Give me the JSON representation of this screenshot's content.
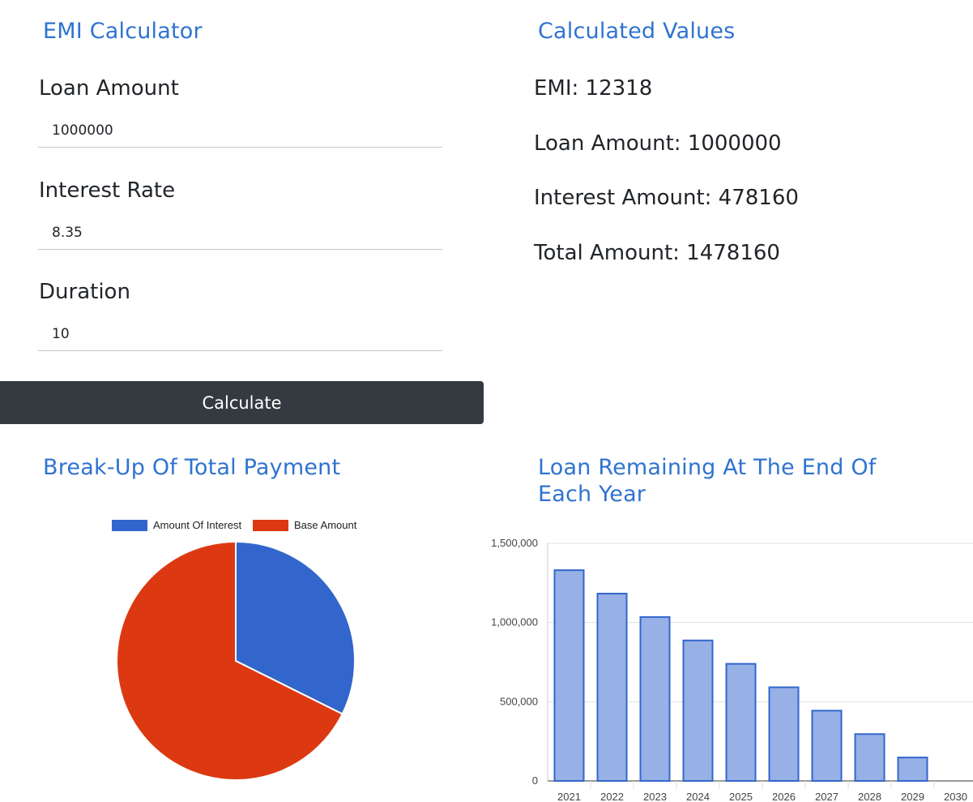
{
  "form": {
    "title": "EMI Calculator",
    "loan_amount_label": "Loan Amount",
    "loan_amount_value": "1000000",
    "interest_rate_label": "Interest Rate",
    "interest_rate_value": "8.35",
    "duration_label": "Duration",
    "duration_value": "10",
    "calculate_label": "Calculate"
  },
  "results": {
    "title": "Calculated Values",
    "emi": "EMI: 12318",
    "loan_amount": "Loan Amount: 1000000",
    "interest_amount": "Interest Amount: 478160",
    "total_amount": "Total Amount: 1478160"
  },
  "pie_section": {
    "title": "Break-Up Of Total Payment"
  },
  "bar_section": {
    "title_line1": "Loan Remaining At The End Of",
    "title_line2": "Each Year"
  },
  "colors": {
    "interest": "#3366cc",
    "base": "#dc3912",
    "bar_fill": "#97b0e6",
    "bar_stroke": "#3366cc",
    "heading": "#2f73d0"
  },
  "chart_data": [
    {
      "type": "pie",
      "legend_position": "top",
      "series": [
        {
          "name": "Amount Of Interest",
          "value": 478160
        },
        {
          "name": "Base Amount",
          "value": 1000000
        }
      ]
    },
    {
      "type": "bar",
      "categories": [
        "2021",
        "2022",
        "2023",
        "2024",
        "2025",
        "2026",
        "2027",
        "2028",
        "2029",
        "2030"
      ],
      "values": [
        1330344,
        1182528,
        1034712,
        886896,
        739080,
        591264,
        443448,
        295632,
        147816,
        0
      ],
      "ylim": [
        0,
        1500000
      ],
      "yticks": [
        0,
        500000,
        1000000,
        1500000
      ],
      "ytick_labels": [
        "0",
        "500,000",
        "1,000,000",
        "1,500,000"
      ],
      "grid": true
    }
  ]
}
